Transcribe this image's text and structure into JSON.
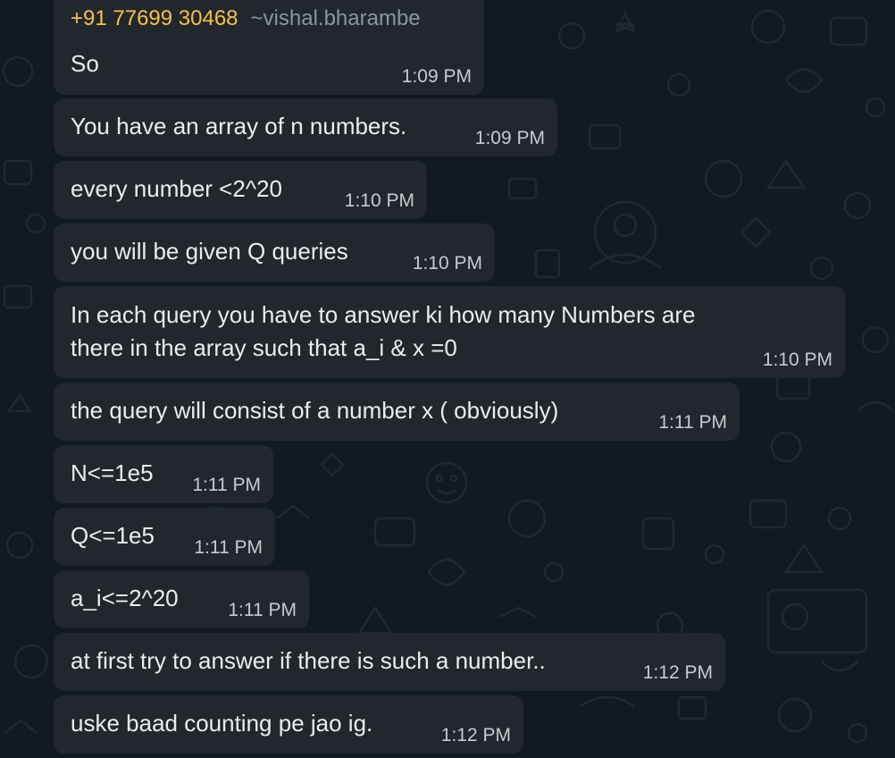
{
  "sender": {
    "phone": "+91 77699 30468",
    "name": "~vishal.bharambe"
  },
  "messages": [
    {
      "lines": [
        "So"
      ],
      "time": "1:09 PM"
    },
    {
      "lines": [
        "You have an array of n numbers."
      ],
      "time": "1:09 PM"
    },
    {
      "lines": [
        "every number <2^20"
      ],
      "time": "1:10 PM"
    },
    {
      "lines": [
        "you will be given Q queries"
      ],
      "time": "1:10 PM"
    },
    {
      "lines": [
        "In each query you have to answer ki how many Numbers are",
        "there in the array such that a_i & x =0"
      ],
      "time": "1:10 PM"
    },
    {
      "lines": [
        "the query will consist of a number x ( obviously)"
      ],
      "time": "1:11 PM"
    },
    {
      "lines": [
        "N<=1e5"
      ],
      "time": "1:11 PM"
    },
    {
      "lines": [
        "Q<=1e5"
      ],
      "time": "1:11 PM"
    },
    {
      "lines": [
        "a_i<=2^20"
      ],
      "time": "1:11 PM"
    },
    {
      "lines": [
        "at first try to answer if there is such a number.."
      ],
      "time": "1:12 PM"
    },
    {
      "lines": [
        "uske baad counting pe jao ig."
      ],
      "time": "1:12 PM"
    }
  ]
}
